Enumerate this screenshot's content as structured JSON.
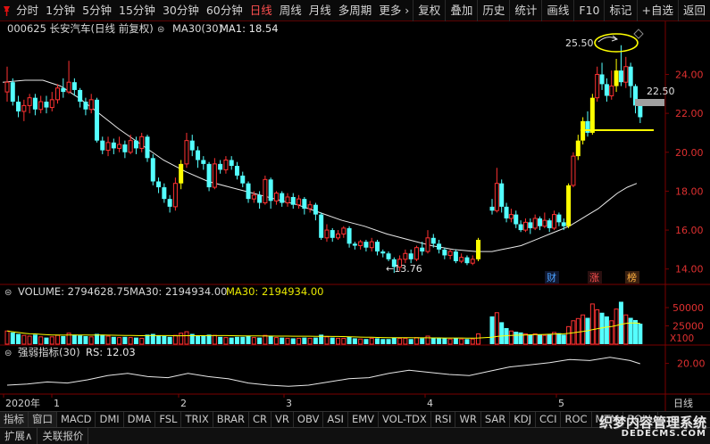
{
  "toolbar": {
    "left": [
      "分时",
      "1分钟",
      "5分钟",
      "15分钟",
      "30分钟",
      "60分钟",
      "日线",
      "周线",
      "月线",
      "多周期",
      "更多 ›"
    ],
    "active_index": 6,
    "right": [
      "复权",
      "叠加",
      "历史",
      "统计",
      "画线",
      "F10",
      "标记",
      "+自选",
      "返回"
    ]
  },
  "header": {
    "stock": "000625 长安汽车(日线 前复权)",
    "ma_label": "MA30(30)",
    "ma_value": "MA1: 18.54"
  },
  "volume_header": {
    "volume": "VOLUME: 2794628.75",
    "ma30a": "MA30: 2194934.00",
    "ma30b": "MA30: 2194934.00"
  },
  "rs_header": {
    "name": "强弱指标(30)",
    "value": "RS: 12.03"
  },
  "axes": {
    "price_ticks": [
      "24.00",
      "22.00",
      "20.00",
      "18.00",
      "16.00",
      "14.00"
    ],
    "volume_ticks": [
      "50000",
      "25000"
    ],
    "volume_unit": "X100",
    "rs_ticks": [
      "20.00"
    ],
    "date_labels": [
      "2020年",
      "1",
      "2",
      "3",
      "4",
      "5"
    ],
    "period_label": "日线"
  },
  "annotations": {
    "low": "←13.76",
    "high": "25.50",
    "current": "22.50"
  },
  "event_tags": [
    "财",
    "涨",
    "榜"
  ],
  "indicator_tabs": [
    "指标",
    "窗口",
    "MACD",
    "DMI",
    "DMA",
    "FSL",
    "TRIX",
    "BRAR",
    "CR",
    "VR",
    "OBV",
    "ASI",
    "EMV",
    "VOL-TDX",
    "RSI",
    "WR",
    "SAR",
    "KDJ",
    "CCI",
    "ROC",
    "MTM",
    "BOLL"
  ],
  "status_tabs": [
    "扩展∧",
    "关联报价"
  ],
  "watermark": {
    "line1": "织梦内容管理系统",
    "line2": "DEDECMS.COM"
  },
  "colors": {
    "up": "#ff3232",
    "down": "#54ffff",
    "ma": "#e8e8e8",
    "highlight": "#ffff00",
    "volume_ma": "#ffff00",
    "axis": "#7a0000"
  },
  "chart_data": {
    "type": "candlestick",
    "price_range": [
      13.3,
      25.9
    ],
    "volume_range": [
      0,
      61000
    ],
    "candles": [
      {
        "o": 23.1,
        "c": 23.6,
        "h": 24.4,
        "l": 22.6,
        "v": 18000
      },
      {
        "o": 23.6,
        "c": 22.6,
        "h": 23.8,
        "l": 22.4,
        "v": 16000
      },
      {
        "o": 22.6,
        "c": 22.1,
        "h": 22.9,
        "l": 21.8,
        "v": 14000
      },
      {
        "o": 22.1,
        "c": 22.4,
        "h": 22.7,
        "l": 21.6,
        "v": 12000
      },
      {
        "o": 22.4,
        "c": 22.8,
        "h": 23.0,
        "l": 22.0,
        "v": 11000
      },
      {
        "o": 22.8,
        "c": 22.2,
        "h": 23.0,
        "l": 21.9,
        "v": 13000
      },
      {
        "o": 22.2,
        "c": 22.6,
        "h": 22.9,
        "l": 22.0,
        "v": 10000
      },
      {
        "o": 22.6,
        "c": 22.3,
        "h": 22.9,
        "l": 22.0,
        "v": 9000
      },
      {
        "o": 22.3,
        "c": 22.7,
        "h": 23.1,
        "l": 22.1,
        "v": 10000
      },
      {
        "o": 22.7,
        "c": 23.3,
        "h": 23.5,
        "l": 22.5,
        "v": 12000
      },
      {
        "o": 23.3,
        "c": 23.1,
        "h": 23.8,
        "l": 22.8,
        "v": 11000
      },
      {
        "o": 23.1,
        "c": 23.6,
        "h": 24.7,
        "l": 23.0,
        "v": 15000
      },
      {
        "o": 23.6,
        "c": 23.2,
        "h": 23.8,
        "l": 22.9,
        "v": 13000
      },
      {
        "o": 23.2,
        "c": 22.6,
        "h": 23.3,
        "l": 22.3,
        "v": 12000
      },
      {
        "o": 22.6,
        "c": 22.2,
        "h": 22.8,
        "l": 21.9,
        "v": 11000
      },
      {
        "o": 22.2,
        "c": 22.7,
        "h": 23.0,
        "l": 22.0,
        "v": 10000
      },
      {
        "o": 22.7,
        "c": 20.6,
        "h": 22.8,
        "l": 20.5,
        "v": 14000
      },
      {
        "o": 20.6,
        "c": 20.1,
        "h": 20.8,
        "l": 19.9,
        "v": 13000
      },
      {
        "o": 20.1,
        "c": 20.5,
        "h": 20.8,
        "l": 19.8,
        "v": 11000
      },
      {
        "o": 20.5,
        "c": 20.2,
        "h": 20.7,
        "l": 19.9,
        "v": 10000
      },
      {
        "o": 20.2,
        "c": 20.4,
        "h": 20.8,
        "l": 20.0,
        "v": 9000
      },
      {
        "o": 20.4,
        "c": 20.0,
        "h": 20.6,
        "l": 19.7,
        "v": 10000
      },
      {
        "o": 20.0,
        "c": 20.6,
        "h": 20.9,
        "l": 19.9,
        "v": 9000
      },
      {
        "o": 20.6,
        "c": 20.2,
        "h": 20.8,
        "l": 19.9,
        "v": 9000
      },
      {
        "o": 20.2,
        "c": 20.8,
        "h": 21.0,
        "l": 20.0,
        "v": 8000
      },
      {
        "o": 20.8,
        "c": 19.7,
        "h": 20.9,
        "l": 19.5,
        "v": 13000
      },
      {
        "o": 19.7,
        "c": 18.5,
        "h": 19.9,
        "l": 18.3,
        "v": 14000
      },
      {
        "o": 18.5,
        "c": 18.2,
        "h": 18.7,
        "l": 17.9,
        "v": 12000
      },
      {
        "o": 18.2,
        "c": 17.6,
        "h": 18.4,
        "l": 17.4,
        "v": 11000
      },
      {
        "o": 17.6,
        "c": 17.2,
        "h": 17.8,
        "l": 16.9,
        "v": 10000
      },
      {
        "o": 17.2,
        "c": 18.4,
        "h": 18.7,
        "l": 17.0,
        "v": 12000
      },
      {
        "o": 18.4,
        "c": 19.4,
        "h": 19.6,
        "l": 18.1,
        "v": 15000,
        "hl": true
      },
      {
        "o": 19.4,
        "c": 20.6,
        "h": 21.0,
        "l": 19.2,
        "v": 17000
      },
      {
        "o": 20.6,
        "c": 20.1,
        "h": 20.9,
        "l": 19.8,
        "v": 14000
      },
      {
        "o": 20.1,
        "c": 19.6,
        "h": 20.3,
        "l": 19.2,
        "v": 12000
      },
      {
        "o": 19.6,
        "c": 19.4,
        "h": 19.8,
        "l": 19.1,
        "v": 11000
      },
      {
        "o": 19.4,
        "c": 18.2,
        "h": 19.5,
        "l": 18.0,
        "v": 13000
      },
      {
        "o": 18.2,
        "c": 19.4,
        "h": 19.7,
        "l": 18.1,
        "v": 12000
      },
      {
        "o": 19.4,
        "c": 19.1,
        "h": 19.6,
        "l": 18.9,
        "v": 10000
      },
      {
        "o": 19.1,
        "c": 19.6,
        "h": 19.8,
        "l": 18.9,
        "v": 9000
      },
      {
        "o": 19.6,
        "c": 19.3,
        "h": 19.8,
        "l": 19.1,
        "v": 9000
      },
      {
        "o": 19.3,
        "c": 18.8,
        "h": 19.5,
        "l": 18.6,
        "v": 10000
      },
      {
        "o": 18.8,
        "c": 18.4,
        "h": 19.0,
        "l": 18.2,
        "v": 10000
      },
      {
        "o": 18.4,
        "c": 17.6,
        "h": 18.5,
        "l": 17.4,
        "v": 11000
      },
      {
        "o": 17.6,
        "c": 17.8,
        "h": 18.0,
        "l": 17.4,
        "v": 9000
      },
      {
        "o": 17.8,
        "c": 17.4,
        "h": 18.0,
        "l": 17.1,
        "v": 9000
      },
      {
        "o": 17.4,
        "c": 18.6,
        "h": 18.8,
        "l": 17.3,
        "v": 12000
      },
      {
        "o": 18.6,
        "c": 17.5,
        "h": 18.7,
        "l": 17.1,
        "v": 11000
      },
      {
        "o": 17.5,
        "c": 17.9,
        "h": 18.0,
        "l": 17.3,
        "v": 9000
      },
      {
        "o": 17.9,
        "c": 17.4,
        "h": 18.0,
        "l": 17.2,
        "v": 9000
      },
      {
        "o": 17.4,
        "c": 17.7,
        "h": 17.9,
        "l": 17.2,
        "v": 8000
      },
      {
        "o": 17.7,
        "c": 17.3,
        "h": 17.9,
        "l": 17.1,
        "v": 8000
      },
      {
        "o": 17.3,
        "c": 17.6,
        "h": 17.8,
        "l": 17.1,
        "v": 8000
      },
      {
        "o": 17.6,
        "c": 17.1,
        "h": 17.7,
        "l": 16.8,
        "v": 9000
      },
      {
        "o": 17.1,
        "c": 17.3,
        "h": 17.5,
        "l": 16.9,
        "v": 8000
      },
      {
        "o": 17.3,
        "c": 16.8,
        "h": 17.4,
        "l": 16.5,
        "v": 9000
      },
      {
        "o": 16.8,
        "c": 15.6,
        "h": 16.9,
        "l": 15.5,
        "v": 13000
      },
      {
        "o": 15.6,
        "c": 16.0,
        "h": 16.3,
        "l": 15.4,
        "v": 10000
      },
      {
        "o": 16.0,
        "c": 15.6,
        "h": 16.1,
        "l": 15.4,
        "v": 9000
      },
      {
        "o": 15.6,
        "c": 15.8,
        "h": 16.0,
        "l": 15.5,
        "v": 8000
      },
      {
        "o": 15.8,
        "c": 16.1,
        "h": 16.2,
        "l": 15.6,
        "v": 8000
      },
      {
        "o": 16.1,
        "c": 15.3,
        "h": 16.2,
        "l": 15.1,
        "v": 10000
      },
      {
        "o": 15.3,
        "c": 15.2,
        "h": 15.4,
        "l": 15.0,
        "v": 8000
      },
      {
        "o": 15.2,
        "c": 15.4,
        "h": 15.5,
        "l": 15.0,
        "v": 7000
      },
      {
        "o": 15.4,
        "c": 15.1,
        "h": 15.5,
        "l": 14.9,
        "v": 7000
      },
      {
        "o": 15.1,
        "c": 15.4,
        "h": 15.6,
        "l": 14.9,
        "v": 8000
      },
      {
        "o": 15.4,
        "c": 14.9,
        "h": 15.5,
        "l": 14.7,
        "v": 8000
      },
      {
        "o": 14.9,
        "c": 14.8,
        "h": 15.0,
        "l": 14.6,
        "v": 7000
      },
      {
        "o": 14.8,
        "c": 14.5,
        "h": 14.9,
        "l": 14.4,
        "v": 7000
      },
      {
        "o": 14.5,
        "c": 14.1,
        "h": 14.6,
        "l": 13.8,
        "v": 9000
      },
      {
        "o": 14.1,
        "c": 14.5,
        "h": 14.7,
        "l": 13.9,
        "v": 8000
      },
      {
        "o": 14.5,
        "c": 14.8,
        "h": 15.0,
        "l": 14.3,
        "v": 8000
      },
      {
        "o": 14.8,
        "c": 14.5,
        "h": 15.0,
        "l": 14.3,
        "v": 7000
      },
      {
        "o": 14.5,
        "c": 15.1,
        "h": 15.2,
        "l": 14.4,
        "v": 9000
      },
      {
        "o": 15.1,
        "c": 14.9,
        "h": 15.4,
        "l": 14.7,
        "v": 8000
      },
      {
        "o": 14.9,
        "c": 15.6,
        "h": 16.0,
        "l": 14.8,
        "v": 11000
      },
      {
        "o": 15.6,
        "c": 15.3,
        "h": 15.8,
        "l": 15.1,
        "v": 9000
      },
      {
        "o": 15.3,
        "c": 15.0,
        "h": 15.5,
        "l": 14.8,
        "v": 8000
      },
      {
        "o": 15.0,
        "c": 14.7,
        "h": 15.1,
        "l": 14.5,
        "v": 8000
      },
      {
        "o": 14.7,
        "c": 14.9,
        "h": 15.0,
        "l": 14.5,
        "v": 7000
      },
      {
        "o": 14.9,
        "c": 14.4,
        "h": 15.0,
        "l": 14.3,
        "v": 8000
      },
      {
        "o": 14.4,
        "c": 14.6,
        "h": 14.8,
        "l": 14.3,
        "v": 7000
      },
      {
        "o": 14.6,
        "c": 14.3,
        "h": 14.7,
        "l": 14.2,
        "v": 7000
      },
      {
        "o": 14.3,
        "c": 14.5,
        "h": 14.7,
        "l": 14.2,
        "v": 7000
      },
      {
        "o": 14.5,
        "c": 15.5,
        "h": 15.6,
        "l": 14.4,
        "v": 14000,
        "hl": true
      },
      {
        "o": 17.2,
        "c": 17.0,
        "h": 17.6,
        "l": 16.8,
        "v": 38000
      },
      {
        "o": 17.0,
        "c": 18.4,
        "h": 19.2,
        "l": 16.9,
        "v": 43000
      },
      {
        "o": 18.4,
        "c": 17.2,
        "h": 18.6,
        "l": 16.9,
        "v": 30000
      },
      {
        "o": 17.2,
        "c": 16.6,
        "h": 17.4,
        "l": 16.4,
        "v": 22000
      },
      {
        "o": 16.6,
        "c": 16.8,
        "h": 17.1,
        "l": 16.4,
        "v": 18000
      },
      {
        "o": 16.8,
        "c": 16.3,
        "h": 17.0,
        "l": 16.1,
        "v": 17000
      },
      {
        "o": 16.3,
        "c": 16.0,
        "h": 16.5,
        "l": 15.9,
        "v": 16000
      },
      {
        "o": 16.0,
        "c": 16.4,
        "h": 16.6,
        "l": 15.9,
        "v": 14000
      },
      {
        "o": 16.4,
        "c": 16.1,
        "h": 16.6,
        "l": 15.8,
        "v": 13000
      },
      {
        "o": 16.1,
        "c": 16.6,
        "h": 16.8,
        "l": 16.0,
        "v": 14000
      },
      {
        "o": 16.6,
        "c": 16.2,
        "h": 16.7,
        "l": 16.0,
        "v": 13000
      },
      {
        "o": 16.2,
        "c": 16.5,
        "h": 16.9,
        "l": 16.1,
        "v": 12000
      },
      {
        "o": 16.5,
        "c": 16.1,
        "h": 16.6,
        "l": 15.9,
        "v": 14000
      },
      {
        "o": 16.1,
        "c": 16.8,
        "h": 17.0,
        "l": 16.0,
        "v": 16000
      },
      {
        "o": 16.8,
        "c": 16.4,
        "h": 16.9,
        "l": 16.2,
        "v": 15000
      },
      {
        "o": 16.4,
        "c": 16.2,
        "h": 16.6,
        "l": 16.0,
        "v": 13000
      },
      {
        "o": 16.2,
        "c": 18.3,
        "h": 18.4,
        "l": 16.1,
        "v": 24000,
        "hl": true
      },
      {
        "o": 18.3,
        "c": 19.8,
        "h": 20.0,
        "l": 18.2,
        "v": 32000
      },
      {
        "o": 19.8,
        "c": 20.6,
        "h": 20.9,
        "l": 19.6,
        "v": 35000,
        "hl": true
      },
      {
        "o": 20.6,
        "c": 21.6,
        "h": 21.8,
        "l": 20.4,
        "v": 40000,
        "hl": true
      },
      {
        "o": 21.6,
        "c": 21.0,
        "h": 22.1,
        "l": 20.8,
        "v": 36000
      },
      {
        "o": 21.0,
        "c": 22.8,
        "h": 23.0,
        "l": 20.9,
        "v": 55000,
        "hl": true
      },
      {
        "o": 22.8,
        "c": 24.0,
        "h": 24.4,
        "l": 22.6,
        "v": 47000
      },
      {
        "o": 24.0,
        "c": 23.5,
        "h": 24.6,
        "l": 23.2,
        "v": 43000
      },
      {
        "o": 23.5,
        "c": 22.9,
        "h": 23.8,
        "l": 22.6,
        "v": 38000
      },
      {
        "o": 22.9,
        "c": 23.4,
        "h": 24.2,
        "l": 22.7,
        "v": 32000
      },
      {
        "o": 23.4,
        "c": 24.2,
        "h": 24.8,
        "l": 23.1,
        "v": 48000,
        "hl": true
      },
      {
        "o": 24.2,
        "c": 23.6,
        "h": 25.5,
        "l": 23.4,
        "v": 58000
      },
      {
        "o": 23.6,
        "c": 24.4,
        "h": 24.9,
        "l": 23.3,
        "v": 40000
      },
      {
        "o": 24.4,
        "c": 23.4,
        "h": 24.6,
        "l": 22.8,
        "v": 36000
      },
      {
        "o": 23.4,
        "c": 22.4,
        "h": 23.5,
        "l": 22.0,
        "v": 33000
      },
      {
        "o": 22.4,
        "c": 21.8,
        "h": 22.6,
        "l": 21.5,
        "v": 28000
      }
    ],
    "ma30_points": [
      [
        0,
        23.6
      ],
      [
        10,
        23.7
      ],
      [
        18,
        23.7
      ],
      [
        26,
        23.4
      ],
      [
        34,
        22.8
      ],
      [
        42,
        22.1
      ],
      [
        52,
        21.2
      ],
      [
        62,
        20.4
      ],
      [
        72,
        19.6
      ],
      [
        82,
        19.0
      ],
      [
        92,
        18.5
      ],
      [
        102,
        18.2
      ],
      [
        112,
        17.9
      ],
      [
        122,
        17.6
      ],
      [
        132,
        17.3
      ],
      [
        142,
        16.9
      ],
      [
        152,
        16.5
      ],
      [
        162,
        16.2
      ],
      [
        172,
        15.8
      ],
      [
        182,
        15.5
      ],
      [
        192,
        15.2
      ],
      [
        202,
        15.0
      ],
      [
        212,
        14.9
      ],
      [
        216,
        14.9
      ],
      [
        220,
        15.0
      ],
      [
        224,
        15.1
      ],
      [
        228,
        15.2
      ],
      [
        232,
        15.4
      ],
      [
        236,
        15.6
      ],
      [
        240,
        15.8
      ],
      [
        244,
        16.0
      ],
      [
        248,
        16.2
      ],
      [
        252,
        16.5
      ],
      [
        256,
        16.8
      ],
      [
        260,
        17.1
      ],
      [
        264,
        17.5
      ],
      [
        268,
        17.9
      ],
      [
        272,
        18.2
      ],
      [
        276,
        18.4
      ]
    ],
    "rs_points": [
      [
        0,
        15.6
      ],
      [
        10,
        15.8
      ],
      [
        20,
        16.2
      ],
      [
        30,
        16.0
      ],
      [
        40,
        16.6
      ],
      [
        50,
        17.4
      ],
      [
        60,
        17.8
      ],
      [
        70,
        17.2
      ],
      [
        80,
        17.0
      ],
      [
        90,
        17.8
      ],
      [
        100,
        17.2
      ],
      [
        110,
        16.8
      ],
      [
        120,
        16.0
      ],
      [
        130,
        15.6
      ],
      [
        140,
        15.4
      ],
      [
        150,
        15.6
      ],
      [
        160,
        16.2
      ],
      [
        170,
        16.8
      ],
      [
        180,
        17.0
      ],
      [
        190,
        17.8
      ],
      [
        200,
        18.4
      ],
      [
        210,
        18.0
      ],
      [
        220,
        17.6
      ],
      [
        230,
        17.4
      ],
      [
        240,
        18.2
      ],
      [
        250,
        19.0
      ],
      [
        260,
        19.4
      ],
      [
        270,
        19.8
      ],
      [
        280,
        20.4
      ],
      [
        290,
        20.2
      ],
      [
        300,
        20.8
      ],
      [
        310,
        20.2
      ],
      [
        315,
        19.6
      ]
    ]
  }
}
